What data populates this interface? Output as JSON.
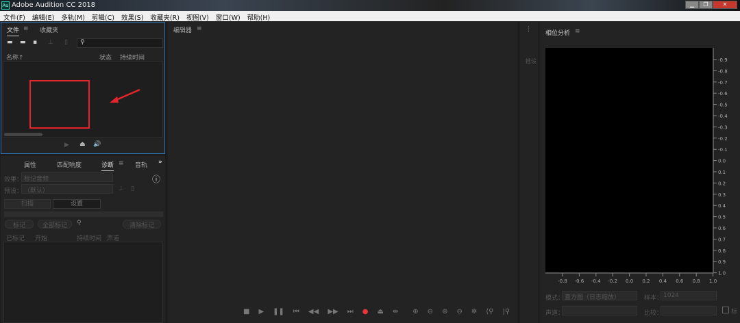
{
  "window": {
    "app_icon": "Au",
    "title": "Adobe Audition CC 2018",
    "min": "▁",
    "restore": "❐",
    "close": "✕"
  },
  "menu": [
    "文件(F)",
    "编辑(E)",
    "多轨(M)",
    "剪辑(C)",
    "效果(S)",
    "收藏夹(R)",
    "视图(V)",
    "窗口(W)",
    "帮助(H)"
  ],
  "files_panel": {
    "tabs": [
      "文件",
      "收藏夹"
    ],
    "menu_icon": "≡",
    "columns": [
      "名称",
      "状态",
      "持续时间"
    ],
    "sort_icon": "↑"
  },
  "diag_panel": {
    "tabs": [
      "属性",
      "匹配响度",
      "诊断",
      "音轨"
    ],
    "more": "»",
    "effect_label": "效果：",
    "effect_value": "标记音频",
    "preset_label": "预设：",
    "preset_value": "（默认）",
    "scan": "扫描",
    "settings": "设置",
    "mark": "标记",
    "mark_all": "全部标记",
    "clear_marks": "清除标记",
    "columns": [
      "已标记",
      "开始",
      "持续时间",
      "声道"
    ]
  },
  "editor": {
    "title": "编辑器"
  },
  "side_tab": {
    "label": "推设"
  },
  "phase": {
    "title": "相位分析",
    "y_ticks": [
      "-0.9",
      "-0.8",
      "-0.7",
      "-0.6",
      "-0.5",
      "-0.4",
      "-0.3",
      "-0.2",
      "-0.1",
      "0.0",
      "0.1",
      "0.2",
      "0.3",
      "0.4",
      "0.5",
      "0.6",
      "0.7",
      "0.8",
      "0.9",
      "1.0"
    ],
    "x_ticks": [
      "-0.8",
      "-0.6",
      "-0.4",
      "-0.2",
      "0.0",
      "0.2",
      "0.4",
      "0.6",
      "0.8",
      "1.0"
    ],
    "mode_label": "模式：",
    "mode_value": "直方图（日志缩放）",
    "samples_label": "样本：",
    "samples_value": "1024",
    "channel_label": "声道：",
    "compare_label": "比较：",
    "checkbox_label": "标"
  },
  "colors": {
    "record": "#e8343a",
    "annotation": "#e5252a",
    "focus": "#2d6fb0"
  }
}
